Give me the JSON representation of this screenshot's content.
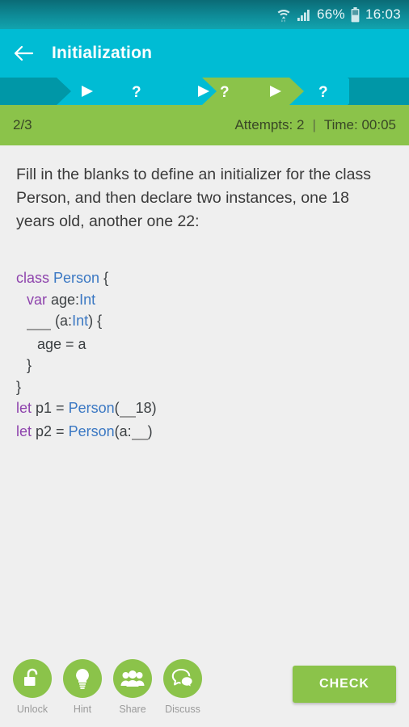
{
  "status_bar": {
    "wifi_icon": "wifi-icon",
    "signal_icon": "cellular-signal-icon",
    "battery_percent": "66%",
    "battery_icon": "battery-icon",
    "clock": "16:03"
  },
  "app_bar": {
    "back_icon": "back-arrow-icon",
    "title": "Initialization"
  },
  "breadcrumb": {
    "steps": [
      {
        "icon": "play-icon",
        "state": "done",
        "label": "▶"
      },
      {
        "icon": "question-icon",
        "state": "done",
        "label": "?"
      },
      {
        "icon": "play-icon",
        "state": "done",
        "label": "▶"
      },
      {
        "icon": "question-icon",
        "state": "current",
        "label": "?"
      },
      {
        "icon": "play-icon",
        "state": "todo",
        "label": "▶"
      },
      {
        "icon": "question-icon",
        "state": "todo",
        "label": "?"
      }
    ]
  },
  "meta_bar": {
    "progress": "2/3",
    "attempts": "Attempts: 2",
    "separator": "|",
    "time": "Time: 00:05"
  },
  "main": {
    "question": "Fill in the blanks to define an initializer for the class Person, and then declare two instances, one 18 years old, another one 22:",
    "code_lines": [
      {
        "indent": 0,
        "tokens": [
          {
            "t": "class ",
            "k": "kw"
          },
          {
            "t": "Person",
            "k": "ty"
          },
          {
            "t": " {",
            "k": "plain"
          }
        ]
      },
      {
        "indent": 1,
        "tokens": [
          {
            "t": "var ",
            "k": "kw"
          },
          {
            "t": "age:",
            "k": "plain"
          },
          {
            "t": "Int",
            "k": "ty"
          }
        ]
      },
      {
        "indent": 1,
        "tokens": [
          {
            "t": "___",
            "k": "blank"
          },
          {
            "t": " (a:",
            "k": "plain"
          },
          {
            "t": "Int",
            "k": "ty"
          },
          {
            "t": ") {",
            "k": "plain"
          }
        ]
      },
      {
        "indent": 2,
        "tokens": [
          {
            "t": "age = a",
            "k": "plain"
          }
        ]
      },
      {
        "indent": 1,
        "tokens": [
          {
            "t": "}",
            "k": "plain"
          }
        ]
      },
      {
        "indent": 0,
        "tokens": [
          {
            "t": "}",
            "k": "plain"
          }
        ]
      },
      {
        "indent": 0,
        "tokens": [
          {
            "t": "let ",
            "k": "kw"
          },
          {
            "t": "p1 = ",
            "k": "plain"
          },
          {
            "t": "Person",
            "k": "ty"
          },
          {
            "t": "(",
            "k": "plain"
          },
          {
            "t": "__",
            "k": "blank"
          },
          {
            "t": "18)",
            "k": "plain"
          }
        ]
      },
      {
        "indent": 0,
        "tokens": [
          {
            "t": "let ",
            "k": "kw"
          },
          {
            "t": "p2 = ",
            "k": "plain"
          },
          {
            "t": "Person",
            "k": "ty"
          },
          {
            "t": "(a:",
            "k": "plain"
          },
          {
            "t": "__",
            "k": "blank"
          },
          {
            "t": ")",
            "k": "plain"
          }
        ]
      }
    ]
  },
  "bottom_bar": {
    "actions": [
      {
        "icon": "unlock-padlock-icon",
        "label": "Unlock"
      },
      {
        "icon": "lightbulb-icon",
        "label": "Hint"
      },
      {
        "icon": "people-group-icon",
        "label": "Share"
      },
      {
        "icon": "speech-bubbles-icon",
        "label": "Discuss"
      }
    ],
    "check_label": "CHECK"
  },
  "colors": {
    "status_bar": "#0e8c98",
    "app_bar": "#00bcd4",
    "crumb_track": "#0097a7",
    "crumb_done": "#00bcd4",
    "crumb_current": "#8bc34a",
    "accent_green": "#8bc34a",
    "page_bg": "#efefef",
    "keyword": "#8e44ad",
    "type": "#3b78c3",
    "code_text": "#3c4043"
  }
}
